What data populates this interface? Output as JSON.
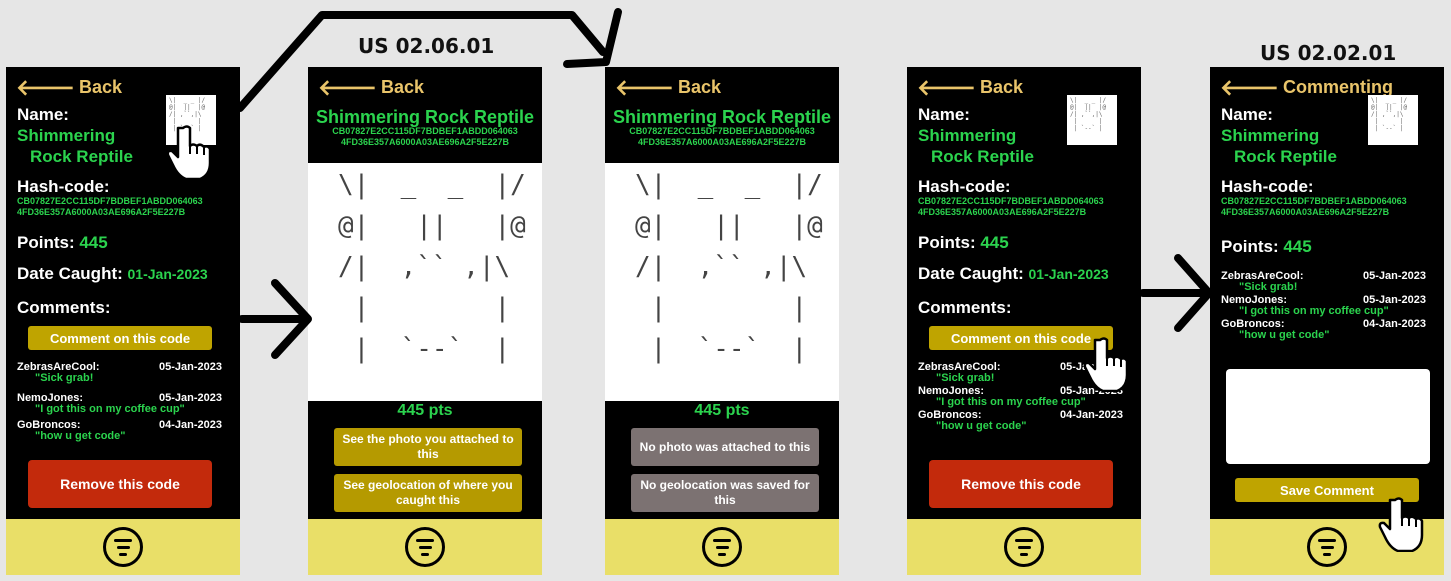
{
  "labels": {
    "story_a": "US 02.06.01",
    "story_b": "US 02.02.01"
  },
  "common": {
    "back": "Back",
    "points_label": "Points:",
    "date_label": "Date Caught:",
    "hash_label": "Hash-code:",
    "name_label": "Name:",
    "comments_label": "Comments:"
  },
  "monster": {
    "name_line1": "Shimmering",
    "name_line2": "Rock Reptile",
    "full_name": "Shimmering Rock Reptile",
    "hash_line1": "CB07827E2CC115DF7BDBEF1ABDD064063",
    "hash_line2": "4FD36E357A6000A03AE696A2F5E227B",
    "points": "445",
    "points_text": "445 pts",
    "date": "01-Jan-2023"
  },
  "comment_button": "Comment on this code",
  "remove_button": "Remove this code",
  "comments": [
    {
      "user": "ZebrasAreCool:",
      "date": "05-Jan-2023",
      "text": "\"Sick grab!"
    },
    {
      "user": "NemoJones:",
      "date": "05-Jan-2023",
      "text": "\"I got this on my coffee cup\""
    },
    {
      "user": "GoBroncos:",
      "date": "04-Jan-2023",
      "text": "\"how u get code\""
    }
  ],
  "screen2": {
    "photo_btn": "See the photo you attached to this",
    "geo_btn": "See geolocation of where you caught this"
  },
  "screen3": {
    "photo_btn": "No photo was attached to this",
    "geo_btn": "No geolocation was saved for this"
  },
  "screen5": {
    "header": "Commenting",
    "save_btn": "Save Comment"
  },
  "ascii_art": "\\|  _  _  |/\n@|   ||   |@\n/|  ,`` ,|\\\n |        |\n |  `--`  |",
  "thumb_art": "\\|  _ _ |/\n@|  ||  |@\n/| ,``,|\\\n |      |\n | `--` |",
  "colors": {
    "accent_green": "#2bd34e",
    "footer": "#e9df68",
    "button_yellow": "#bfa400",
    "remove_red": "#c32a0c",
    "back_gold": "#e9c46a"
  },
  "icons": [
    "back-arrow-icon",
    "menu-icon",
    "pointer-hand-icon",
    "flow-arrow-icon"
  ]
}
